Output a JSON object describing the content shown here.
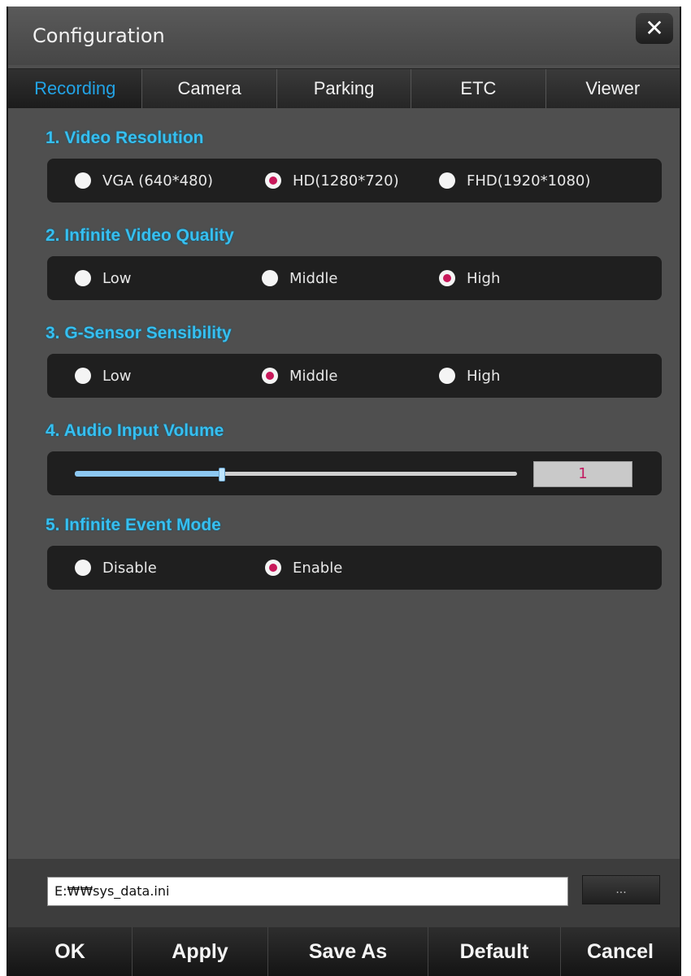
{
  "window": {
    "title": "Configuration",
    "close_label": "✕"
  },
  "tabs": [
    {
      "label": "Recording",
      "active": true
    },
    {
      "label": "Camera",
      "active": false
    },
    {
      "label": "Parking",
      "active": false
    },
    {
      "label": "ETC",
      "active": false
    },
    {
      "label": "Viewer",
      "active": false
    }
  ],
  "sections": {
    "resolution": {
      "title": "1. Video Resolution",
      "options": [
        "VGA (640*480)",
        "HD(1280*720)",
        "FHD(1920*1080)"
      ],
      "selected": "HD(1280*720)"
    },
    "quality": {
      "title": "2. Infinite Video Quality",
      "options": [
        "Low",
        "Middle",
        "High"
      ],
      "selected": "High"
    },
    "gsensor": {
      "title": "3. G-Sensor Sensibility",
      "options": [
        "Low",
        "Middle",
        "High"
      ],
      "selected": "Middle"
    },
    "audio": {
      "title": "4. Audio Input Volume",
      "value": "1",
      "level": 0.33
    },
    "event": {
      "title": "5. Infinite Event Mode",
      "options": [
        "Disable",
        "Enable"
      ],
      "selected": "Enable"
    }
  },
  "file": {
    "path": "E:₩₩sys_data.ini",
    "browse_label": "..."
  },
  "buttons": {
    "ok": "OK",
    "apply": "Apply",
    "save_as": "Save As",
    "default": "Default",
    "cancel": "Cancel"
  },
  "colors": {
    "accent": "#36bff0",
    "radio_selected": "#c8185a",
    "tab_active": "#22a3e6"
  }
}
